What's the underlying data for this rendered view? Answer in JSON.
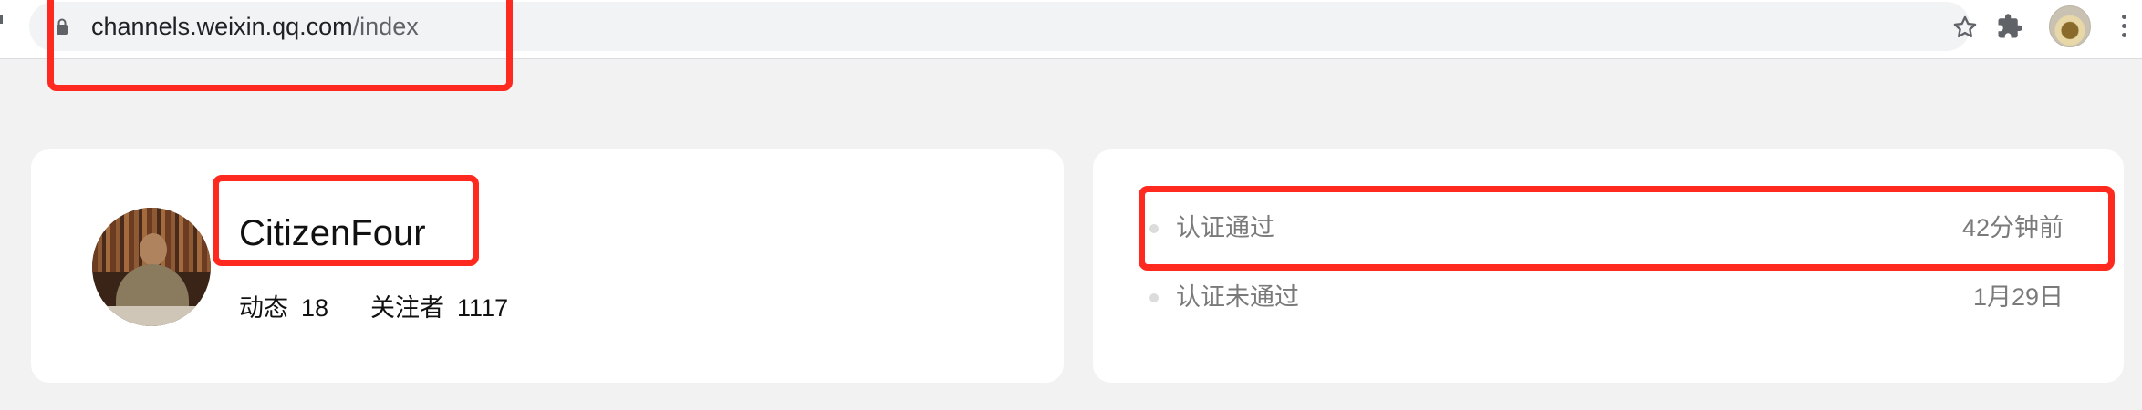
{
  "browser": {
    "url_host": "channels.weixin.qq.com",
    "url_path": "/index"
  },
  "profile": {
    "name": "CitizenFour",
    "stats": [
      {
        "label": "动态",
        "value": "18"
      },
      {
        "label": "关注者",
        "value": "1117"
      }
    ]
  },
  "status": {
    "items": [
      {
        "label": "认证通过",
        "time": "42分钟前"
      },
      {
        "label": "认证未通过",
        "time": "1月29日"
      }
    ]
  },
  "icons": {
    "lock": "lock-icon",
    "star": "star-icon",
    "extensions": "puzzle-icon",
    "menu": "kebab-menu-icon"
  },
  "colors": {
    "highlight": "#ff2a1f",
    "background": "#f2f2f2",
    "card": "#ffffff",
    "muted_text": "#7a7a7a"
  }
}
